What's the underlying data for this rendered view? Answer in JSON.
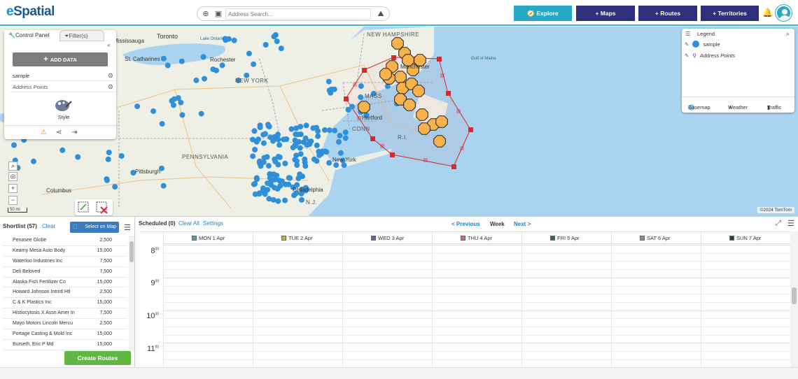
{
  "header": {
    "logo": "eSpatial",
    "search_placeholder": "Address Search...",
    "buttons": {
      "explore": "Explore",
      "maps": "+ Maps",
      "routes": "+ Routes",
      "territories": "+ Territories"
    }
  },
  "map": {
    "labels": {
      "toronto": "Toronto",
      "mississauga": "Mississauga",
      "lake_ontario": "Lake Ontario",
      "st_catharines": "St. Catharines",
      "rochester": "Rochester",
      "new_york_state": "NEW YORK",
      "new_hampshire": "NEW HAMPSHIRE",
      "manchester": "Manchester",
      "gulf_of_maine": "Gulf of Maine",
      "mass": "MASS",
      "hartford": "Hartford",
      "conn": "CONN",
      "ri": "R.I.",
      "pennsylvania": "PENNSYLVANIA",
      "pittsburgh": "Pittsburgh",
      "columbus": "Columbus",
      "new_york_city": "New York",
      "philadelphia": "Philadelphia",
      "nj": "N.J."
    },
    "scale": "50 mi",
    "copyright": "©2024 TomTom",
    "colors": {
      "point": "#2f8fd8",
      "cluster": "#f8b24c",
      "territory": "#e0262b",
      "water": "#a9d3ef",
      "land": "#eef0e6"
    }
  },
  "control_panel": {
    "tab_control": "Control Panel",
    "tab_filters": "Filter(s)",
    "add_data": "ADD DATA",
    "layers": [
      "sample",
      "Address Points"
    ],
    "style_label": "Style"
  },
  "legend": {
    "title": "Legend",
    "items": [
      "sample",
      "Address Points"
    ],
    "footer": {
      "basemap": "Basemap",
      "weather": "Weather",
      "traffic": "Traffic"
    }
  },
  "shortlist": {
    "title": "Shortlist (57)",
    "clear": "Clear",
    "select_on_map": "Select on Map",
    "rows": [
      {
        "name": "Penasee Globe",
        "value": "2,500"
      },
      {
        "name": "Kearny Mesa Auto Body",
        "value": "15,000"
      },
      {
        "name": "Waterloo Industries Inc",
        "value": "7,500"
      },
      {
        "name": "Deli Beloved",
        "value": "7,500"
      },
      {
        "name": "Alaska Fish Fertilizer Co",
        "value": "15,000"
      },
      {
        "name": "Howard Johnson Intrntl Htl",
        "value": "2,500"
      },
      {
        "name": "C & K Plastics Inc",
        "value": "15,000"
      },
      {
        "name": "Histiocytosis X Assn Amer In",
        "value": "7,500"
      },
      {
        "name": "Mayo Motors Lincoln Mercu",
        "value": "2,500"
      },
      {
        "name": "Portage Casting & Mold Inc",
        "value": "15,000"
      },
      {
        "name": "Burseth, Eric P Md",
        "value": "15,000"
      }
    ],
    "create_routes": "Create Routes"
  },
  "schedule": {
    "scheduled": "Scheduled (0)",
    "clear_all": "Clear All",
    "settings": "Settings",
    "previous": "< Previous",
    "week": "Week",
    "next": "Next >",
    "days": [
      {
        "label": "MON 1 Apr",
        "color": "#5a9ea8"
      },
      {
        "label": "TUE 2 Apr",
        "color": "#c8b13a"
      },
      {
        "label": "WED 3 Apr",
        "color": "#6f5ea8"
      },
      {
        "label": "THU 4 Apr",
        "color": "#c86a8f"
      },
      {
        "label": "FRI 5 Apr",
        "color": "#2f6b4a"
      },
      {
        "label": "SAT 6 Apr",
        "color": "#8e8e8e"
      },
      {
        "label": "SUN 7 Apr",
        "color": "#1e4a3e"
      }
    ],
    "hours": [
      "8",
      "9",
      "10",
      "11"
    ],
    "hour_suffix": "00"
  }
}
